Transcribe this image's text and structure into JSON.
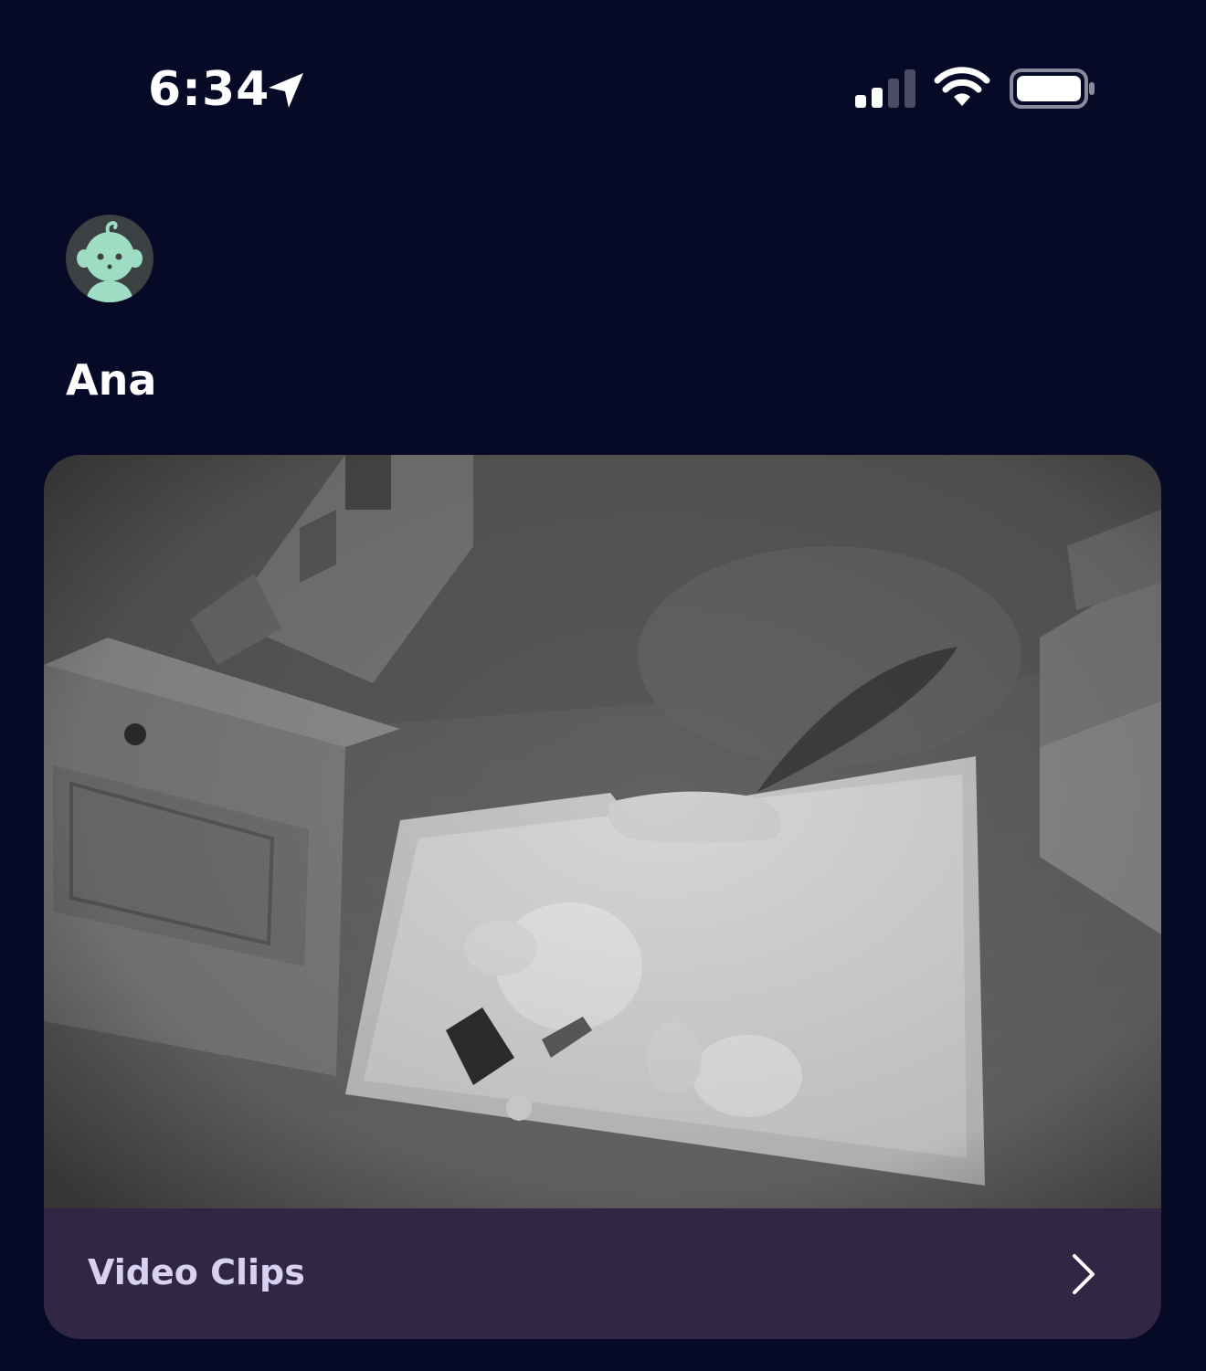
{
  "status_bar": {
    "time": "6:34",
    "icons": [
      "location-arrow-icon",
      "cellular-signal-icon",
      "wifi-icon",
      "battery-icon"
    ]
  },
  "profile": {
    "avatar_icon": "baby-face-icon",
    "avatar_color": "#9fdcc4",
    "name": "Ana"
  },
  "camera": {
    "feed": "night-vision-nursery-view",
    "clips_label": "Video Clips",
    "clips_icon": "chevron-right-icon"
  },
  "colors": {
    "background": "#070a26",
    "card_footer": "#312745",
    "clips_text": "#d8d2f2"
  }
}
